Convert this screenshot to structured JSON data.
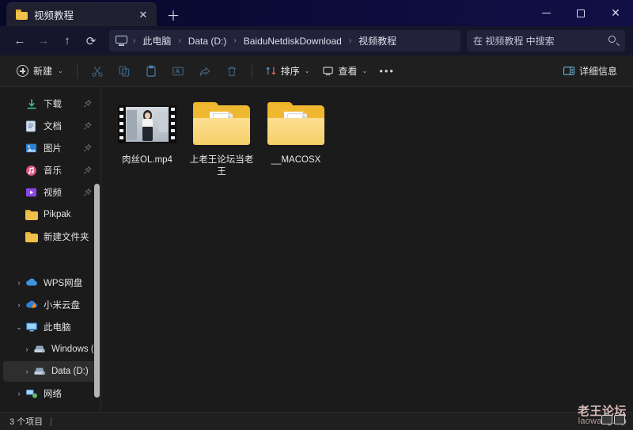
{
  "titlebar": {
    "tab": {
      "title": "视频教程",
      "icon": "folder-icon",
      "close_label": "✕"
    },
    "new_tab_label": "＋",
    "controls": {
      "minimize": "minimize-icon",
      "maximize": "maximize-icon",
      "close": "✕"
    }
  },
  "nav": {
    "back": "←",
    "forward": "→",
    "up": "↑",
    "refresh": "⟳",
    "breadcrumb": [
      "此电脑",
      "Data (D:)",
      "BaiduNetdiskDownload",
      "视频教程"
    ],
    "separator": "›",
    "search": {
      "placeholder": "在 视频教程 中搜索",
      "icon": "search-icon"
    }
  },
  "toolbar": {
    "new_label": "新建",
    "sort_label": "排序",
    "view_label": "查看",
    "more_label": "•••",
    "details_label": "详细信息",
    "chevron": "⌄",
    "icons": [
      "cut-icon",
      "copy-icon",
      "paste-icon",
      "rename-icon",
      "share-icon",
      "delete-icon"
    ]
  },
  "sidebar": {
    "items": [
      {
        "label": "下载",
        "icon": "downloads-icon",
        "pinned": true,
        "caret": "",
        "indent": false
      },
      {
        "label": "文档",
        "icon": "documents-icon",
        "pinned": true,
        "caret": "",
        "indent": false
      },
      {
        "label": "图片",
        "icon": "pictures-icon",
        "pinned": true,
        "caret": "",
        "indent": false
      },
      {
        "label": "音乐",
        "icon": "music-icon",
        "pinned": true,
        "caret": "",
        "indent": false
      },
      {
        "label": "视频",
        "icon": "videos-icon",
        "pinned": true,
        "caret": "",
        "indent": false
      },
      {
        "label": "Pikpak",
        "icon": "folder-icon",
        "pinned": false,
        "caret": "",
        "indent": false
      },
      {
        "label": "新建文件夹",
        "icon": "folder-icon",
        "pinned": false,
        "caret": "",
        "indent": false
      },
      {
        "label": "WPS网盘",
        "icon": "cloud-icon",
        "pinned": false,
        "caret": "›",
        "indent": false
      },
      {
        "label": "小米云盘",
        "icon": "mi-cloud-icon",
        "pinned": false,
        "caret": "›",
        "indent": false
      },
      {
        "label": "此电脑",
        "icon": "this-pc-icon",
        "pinned": false,
        "caret": "⌄",
        "indent": false
      },
      {
        "label": "Windows (C:)",
        "icon": "drive-icon",
        "pinned": false,
        "caret": "›",
        "indent": true
      },
      {
        "label": "Data (D:)",
        "icon": "drive-icon",
        "pinned": false,
        "caret": "›",
        "indent": true,
        "selected": true
      },
      {
        "label": "网络",
        "icon": "network-icon",
        "pinned": false,
        "caret": "›",
        "indent": false
      }
    ]
  },
  "content": {
    "items": [
      {
        "name": "肉丝OL.mp4",
        "type": "video"
      },
      {
        "name": "上老王论坛当老王",
        "type": "folder"
      },
      {
        "name": "__MACOSX",
        "type": "folder"
      }
    ]
  },
  "statusbar": {
    "count_text": "3 个项目"
  },
  "watermark": {
    "main": "老王论坛",
    "sub": "laowang.vip"
  },
  "colors": {
    "titlebar": "#0b0b38",
    "navbar": "#15152b",
    "toolbar": "#1f1f1f",
    "content_bg": "#1b1b1b",
    "folder_yellow": "#f0b830",
    "selected_row": "#2e2e2e"
  }
}
